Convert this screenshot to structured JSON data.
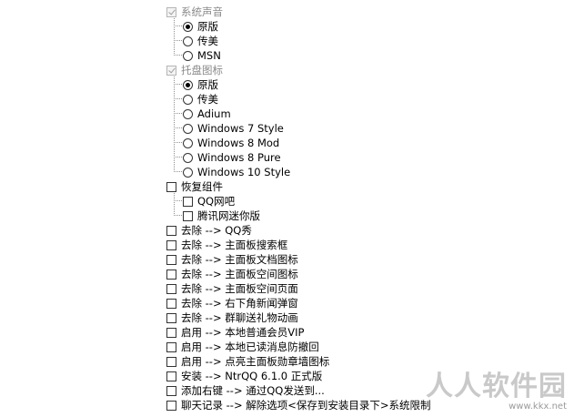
{
  "tree": {
    "sound": {
      "label": "系统声音",
      "options": [
        "原版",
        "传美",
        "MSN"
      ]
    },
    "tray_icon": {
      "label": "托盘图标",
      "options": [
        "原版",
        "传美",
        "Adium",
        "Windows 7 Style",
        "Windows 8 Mod",
        "Windows 8 Pure",
        "Windows 10 Style"
      ]
    },
    "restore": {
      "label": "恢复组件",
      "children": [
        "QQ网吧",
        "腾讯网迷你版"
      ]
    },
    "items": [
      "去除 --> QQ秀",
      "去除 --> 主面板搜索框",
      "去除 --> 主面板文档图标",
      "去除 --> 主面板空间图标",
      "去除 --> 主面板空间页面",
      "去除 --> 右下角新闻弹窗",
      "去除 --> 群聊送礼物动画",
      "启用 --> 本地普通会员VIP",
      "启用 --> 本地已读消息防撤回",
      "启用 --> 点亮主面板勋章墙图标",
      "安装 --> NtrQQ 6.1.0 正式版",
      "添加右键 --> 通过QQ发送到...",
      "聊天记录 --> 解除选项<保存到安装目录下>系统限制"
    ]
  },
  "watermark": {
    "brand": "人人软件园",
    "url": "www.kkx.net"
  }
}
